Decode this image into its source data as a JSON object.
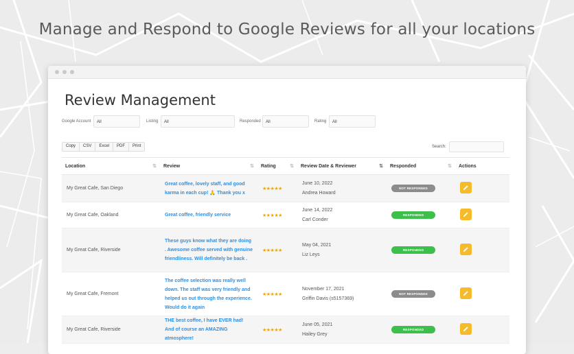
{
  "headline": "Manage and Respond to Google Reviews for all your locations",
  "page_title": "Review Management",
  "filters": [
    {
      "label": "Google Account",
      "value": "All"
    },
    {
      "label": "Listing",
      "value": "All"
    },
    {
      "label": "Responded",
      "value": "All"
    },
    {
      "label": "Rating",
      "value": "All"
    }
  ],
  "exports": [
    "Copy",
    "CSV",
    "Excel",
    "PDF",
    "Print"
  ],
  "search_label": "Search:",
  "columns": [
    "Location",
    "Review",
    "Rating",
    "Review Date & Reviewer",
    "Responded",
    "Actions"
  ],
  "rows": [
    {
      "location": "My Great Cafe, San Diego",
      "review": "Great coffee, lovely staff, and good karma in each cup! 🙏 Thank you x",
      "rating": "★★★★★",
      "date": "June 10, 2022",
      "reviewer": "Andrea Howard",
      "responded": "NOT RESPONDED"
    },
    {
      "location": "My Great Cafe, Oakland",
      "review": "Great coffee, friendly service",
      "rating": "★★★★★",
      "date": "June 14, 2022",
      "reviewer": "Carl Conder",
      "responded": "RESPONDED"
    },
    {
      "location": "My Great Cafe, Riverside",
      "review": "These guys know what they are doing . Awesome coffee served with genuine friendliness. Will definitely be back .",
      "rating": "★★★★★",
      "date": "May 04, 2021",
      "reviewer": "Liz Leys",
      "responded": "RESPONDED"
    },
    {
      "location": "My Great Cafe, Fremont",
      "review": "The coffee selection was really well down. The staff was very friendly and helped us out through the experience. Would do it again",
      "rating": "★★★★★",
      "date": "November 17, 2021",
      "reviewer": "Griffin Davis (s5157369)",
      "responded": "NOT RESPONDED"
    },
    {
      "location": "My Great Cafe, Riverside",
      "review": "THE best coffee, I have EVER had! And of course an AMAZING atmosphere!",
      "rating": "★★★★★",
      "date": "June 05, 2021",
      "reviewer": "Hailey Grey",
      "responded": "RESPONDED"
    }
  ],
  "colors": {
    "accent_blue": "#2f8fe0",
    "star": "#f0a500",
    "responded": "#3cc04b",
    "not_responded": "#8c8c8c",
    "action": "#f6bb2b"
  },
  "icons": {
    "action": "pencil-icon",
    "sort": "sort-arrows-icon"
  }
}
